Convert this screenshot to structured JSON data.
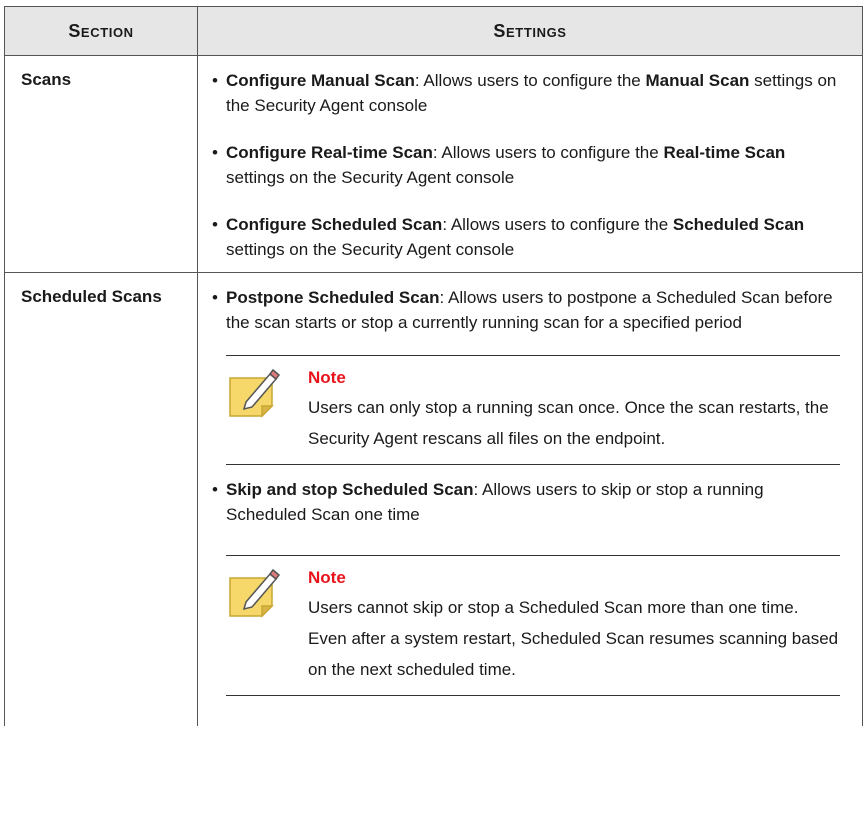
{
  "table": {
    "headers": {
      "section": "Section",
      "settings": "Settings"
    },
    "rows": [
      {
        "section": "Scans",
        "entries": [
          {
            "title": "Configure Manual Scan",
            "pre": ": Allows users to configure the ",
            "emph": "Manual Scan",
            "post": " settings on the Security Agent console"
          },
          {
            "title": "Configure Real-time Scan",
            "pre": ": Allows users to configure the ",
            "emph": "Real-time Scan",
            "post": " settings on the Security Agent console"
          },
          {
            "title": "Configure Scheduled Scan",
            "pre": ": Allows users to configure the ",
            "emph": "Scheduled Scan",
            "post": " settings on the Security Agent console"
          }
        ]
      },
      {
        "section": "Scheduled Scans",
        "entries": [
          {
            "title": "Postpone Scheduled Scan",
            "text": ": Allows users to postpone a Scheduled Scan before the scan starts or stop a currently running scan for a specified period",
            "note": {
              "heading": "Note",
              "text": "Users can only stop a running scan once. Once the scan restarts, the Security Agent rescans all files on the endpoint."
            }
          },
          {
            "title": "Skip and stop Scheduled Scan",
            "text": ": Allows users to skip or stop a running Scheduled Scan one time",
            "note": {
              "heading": "Note",
              "text": "Users cannot skip or stop a Scheduled Scan more than one time. Even after a system restart, Scheduled Scan resumes scanning based on the next scheduled time."
            }
          }
        ]
      }
    ]
  },
  "bullet_char": "•",
  "icons": {
    "note": "note-pencil-icon"
  },
  "colors": {
    "note_heading": "#e8141c",
    "header_bg": "#e6e6e6",
    "note_icon": "#f5d76a"
  }
}
